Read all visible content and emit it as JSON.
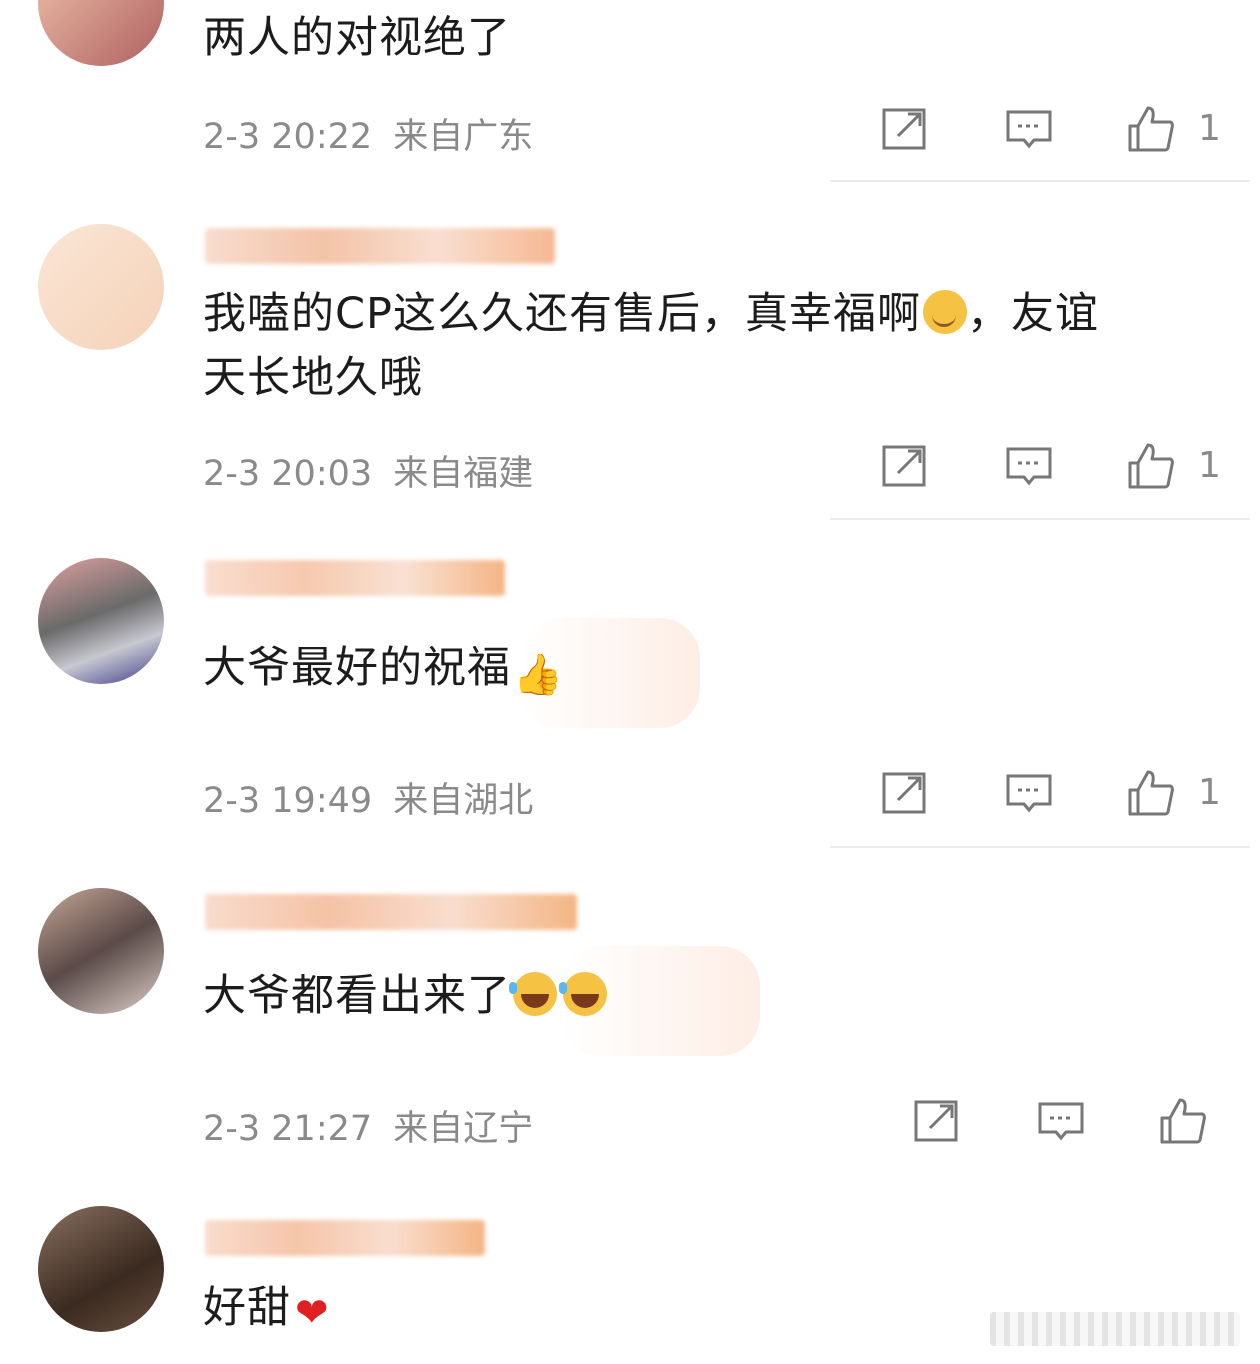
{
  "comments": [
    {
      "text": "两人的对视绝了",
      "time": "2-3 20:22",
      "location": "来自广东",
      "likes": "1"
    },
    {
      "text": "我嗑的CP这么久还有售后，真幸福啊",
      "text_after": "，友谊",
      "text_line2": "天长地久哦",
      "emoji": "hug-face-emoji",
      "time": "2-3 20:03",
      "location": "来自福建",
      "likes": "1"
    },
    {
      "text": "大爷最好的祝福",
      "emoji": "thumbs-up-emoji",
      "time": "2-3 19:49",
      "location": "来自湖北",
      "likes": "1"
    },
    {
      "text": "大爷都看出来了",
      "emoji": "laugh-cry-emoji",
      "time": "2-3 21:27",
      "location": "来自辽宁",
      "likes": ""
    },
    {
      "text": "好甜",
      "emoji": "red-heart-emoji"
    }
  ],
  "icons": {
    "share": "share-icon",
    "comment": "comment-icon",
    "like": "thumbs-up-icon"
  },
  "colors": {
    "meta": "#8a8a8a",
    "text": "#1c1c1c",
    "divider": "#ececec"
  }
}
